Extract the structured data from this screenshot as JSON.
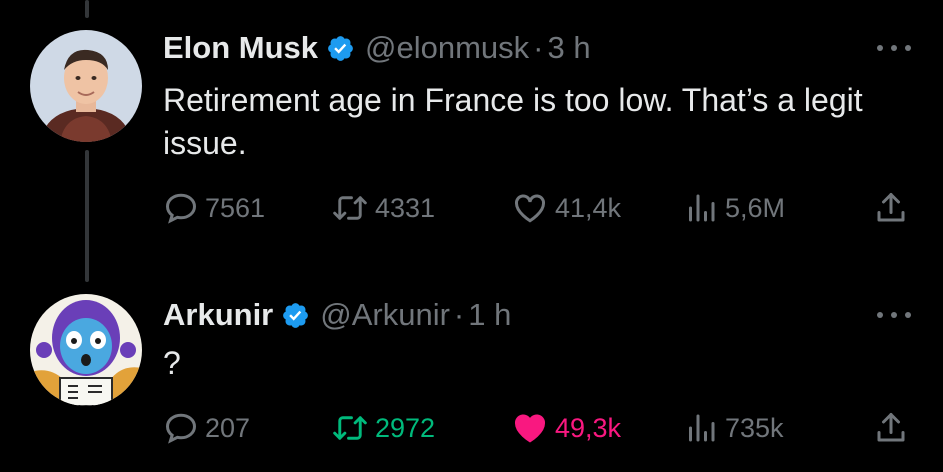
{
  "colors": {
    "background": "#000000",
    "text_primary": "#e7e9ea",
    "text_secondary": "#71767b",
    "verified_blue": "#1d9bf0",
    "retweet_green": "#00ba7c",
    "like_pink": "#f91880"
  },
  "tweets": [
    {
      "display_name": "Elon Musk",
      "verified": true,
      "handle": "@elonmusk",
      "separator": "·",
      "time": "3 h",
      "text": "Retirement age in France is too low. That’s a legit issue.",
      "actions": {
        "replies": "7561",
        "retweets": "4331",
        "likes": "41,4k",
        "views": "5,6M"
      },
      "retweeted": false,
      "liked": false
    },
    {
      "display_name": "Arkunir",
      "verified": true,
      "handle": "@Arkunir",
      "separator": "·",
      "time": "1 h",
      "text": "?",
      "actions": {
        "replies": "207",
        "retweets": "2972",
        "likes": "49,3k",
        "views": "735k"
      },
      "retweeted": true,
      "liked": true
    }
  ],
  "icons": {
    "reply": "reply-icon",
    "retweet": "retweet-icon",
    "like": "heart-icon",
    "views": "views-chart-icon",
    "share": "share-icon",
    "more": "more-dots-icon",
    "verified": "verified-badge-icon"
  }
}
